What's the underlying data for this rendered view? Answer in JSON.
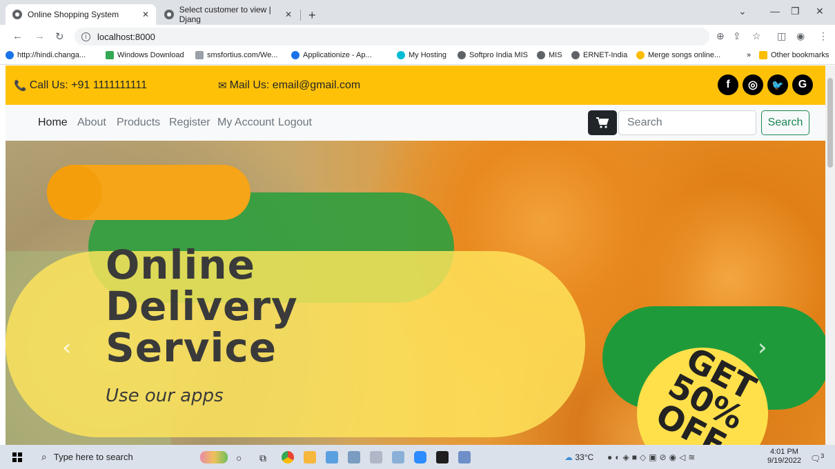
{
  "browser": {
    "tabs": [
      {
        "title": "Online Shopping System",
        "active": true
      },
      {
        "title": "Select customer to view | Djang",
        "active": false
      }
    ],
    "new_tab": "+",
    "url": "localhost:8000",
    "bookmarks": [
      {
        "label": "http://hindi.changa...",
        "color": "#1a73e8"
      },
      {
        "label": "Windows Download",
        "color": "#34a853"
      },
      {
        "label": "smsfortius.com/We...",
        "color": "#9aa0a6"
      },
      {
        "label": "Applicationize - Ap...",
        "color": "#1a73e8"
      },
      {
        "label": "My Hosting",
        "color": "#00bcd4"
      },
      {
        "label": "Softpro India MIS",
        "color": "#5f6368"
      },
      {
        "label": "MIS",
        "color": "#5f6368"
      },
      {
        "label": "ERNET-India",
        "color": "#5f6368"
      },
      {
        "label": "Merge songs online...",
        "color": "#fbbc04"
      }
    ],
    "bookmarks_more": "»",
    "other_bookmarks": "Other bookmarks"
  },
  "site": {
    "call_label": "Call Us: +91 1111111111",
    "mail_label": "Mail Us: email@gmail.com",
    "social": [
      {
        "name": "facebook",
        "glyph": "f"
      },
      {
        "name": "instagram",
        "glyph": "◎"
      },
      {
        "name": "twitter",
        "glyph": "🐦"
      },
      {
        "name": "google",
        "glyph": "G"
      }
    ],
    "nav": [
      "Home",
      "About",
      "Products",
      "Register",
      "My Account",
      "Logout"
    ],
    "search_placeholder": "Search",
    "search_button": "Search",
    "accent_color": "#ffc107"
  },
  "hero": {
    "title_lines": [
      "Online",
      "Delivery",
      "Service"
    ],
    "subtitle": "Use our apps",
    "promo_lines": [
      "GET",
      "50%",
      "OFF"
    ],
    "prev": "‹",
    "next": "›"
  },
  "taskbar": {
    "search_placeholder": "Type here to search",
    "weather": "33°C",
    "time": "4:01 PM",
    "date": "9/19/2022",
    "notifications": "3"
  }
}
